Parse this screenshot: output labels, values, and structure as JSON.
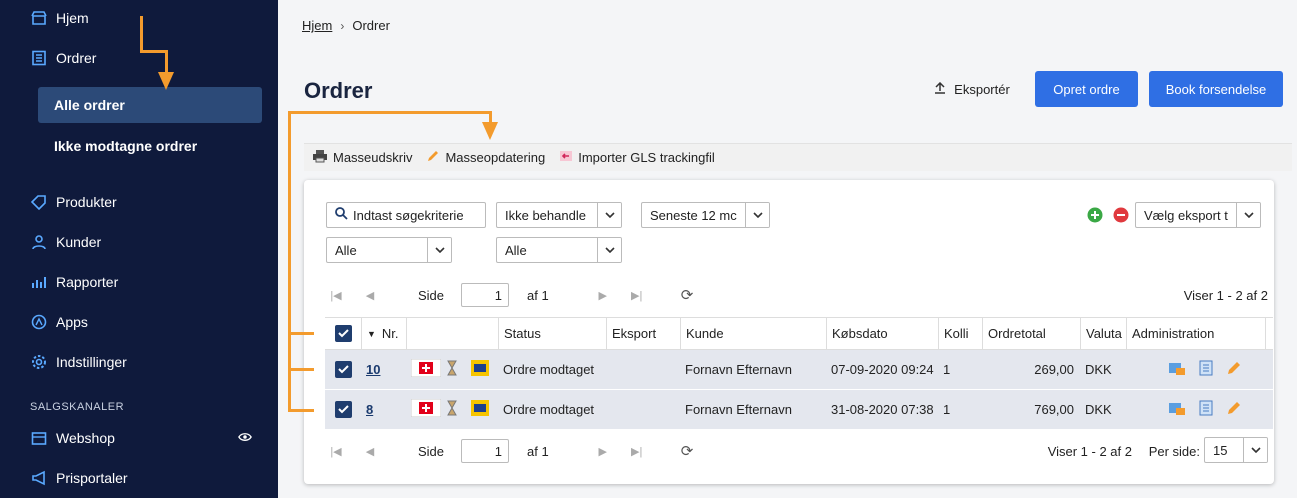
{
  "sidebar": {
    "items": [
      {
        "label": "Hjem",
        "icon": "store-icon"
      },
      {
        "label": "Ordrer",
        "icon": "orders-icon"
      },
      {
        "label": "Produkter",
        "icon": "tag-icon"
      },
      {
        "label": "Kunder",
        "icon": "user-icon"
      },
      {
        "label": "Rapporter",
        "icon": "chart-icon"
      },
      {
        "label": "Apps",
        "icon": "apps-icon"
      },
      {
        "label": "Indstillinger",
        "icon": "gear-icon"
      }
    ],
    "subitems": [
      {
        "label": "Alle ordrer",
        "active": true
      },
      {
        "label": "Ikke modtagne ordrer",
        "active": false
      }
    ],
    "section_label": "SALGSKANALER",
    "channels": [
      {
        "label": "Webshop",
        "icon": "storefront-icon"
      },
      {
        "label": "Prisportaler",
        "icon": "megaphone-icon"
      }
    ]
  },
  "breadcrumb": {
    "home": "Hjem",
    "current": "Ordrer"
  },
  "page_title": "Ordrer",
  "actions": {
    "export": "Eksportér",
    "create": "Opret ordre",
    "book": "Book forsendelse"
  },
  "toolbar": {
    "print": "Masseudskriv",
    "update": "Masseopdatering",
    "import": "Importer GLS trackingfil"
  },
  "filters": {
    "search_placeholder": "Indtast søgekriterie",
    "status": "Ikke behandle",
    "period": "Seneste 12 mc",
    "filter_a": "Alle",
    "filter_b": "Alle",
    "export_select": "Vælg eksport t"
  },
  "pager": {
    "side": "Side",
    "page": "1",
    "of": "af 1",
    "of_bottom": "af 1",
    "showing": "Viser 1 - 2 af 2",
    "per_page_label": "Per side:",
    "per_page": "15"
  },
  "table": {
    "headers": [
      "Nr.",
      "Status",
      "Eksport",
      "Kunde",
      "Købsdato",
      "Kolli",
      "Ordretotal",
      "Valuta",
      "Administration"
    ],
    "rows": [
      {
        "nr": "10",
        "status": "Ordre modtaget",
        "eksport": "",
        "kunde": "Fornavn Efternavn",
        "dato": "07-09-2020 09:24",
        "kolli": "1",
        "total": "269,00",
        "valuta": "DKK"
      },
      {
        "nr": "8",
        "status": "Ordre modtaget",
        "eksport": "",
        "kunde": "Fornavn Efternavn",
        "dato": "31-08-2020 07:38",
        "kolli": "1",
        "total": "769,00",
        "valuta": "DKK"
      }
    ]
  },
  "colors": {
    "sidebar": "#0f1a3c",
    "accent": "#2f6fe4",
    "annotation": "#f39b2d"
  }
}
